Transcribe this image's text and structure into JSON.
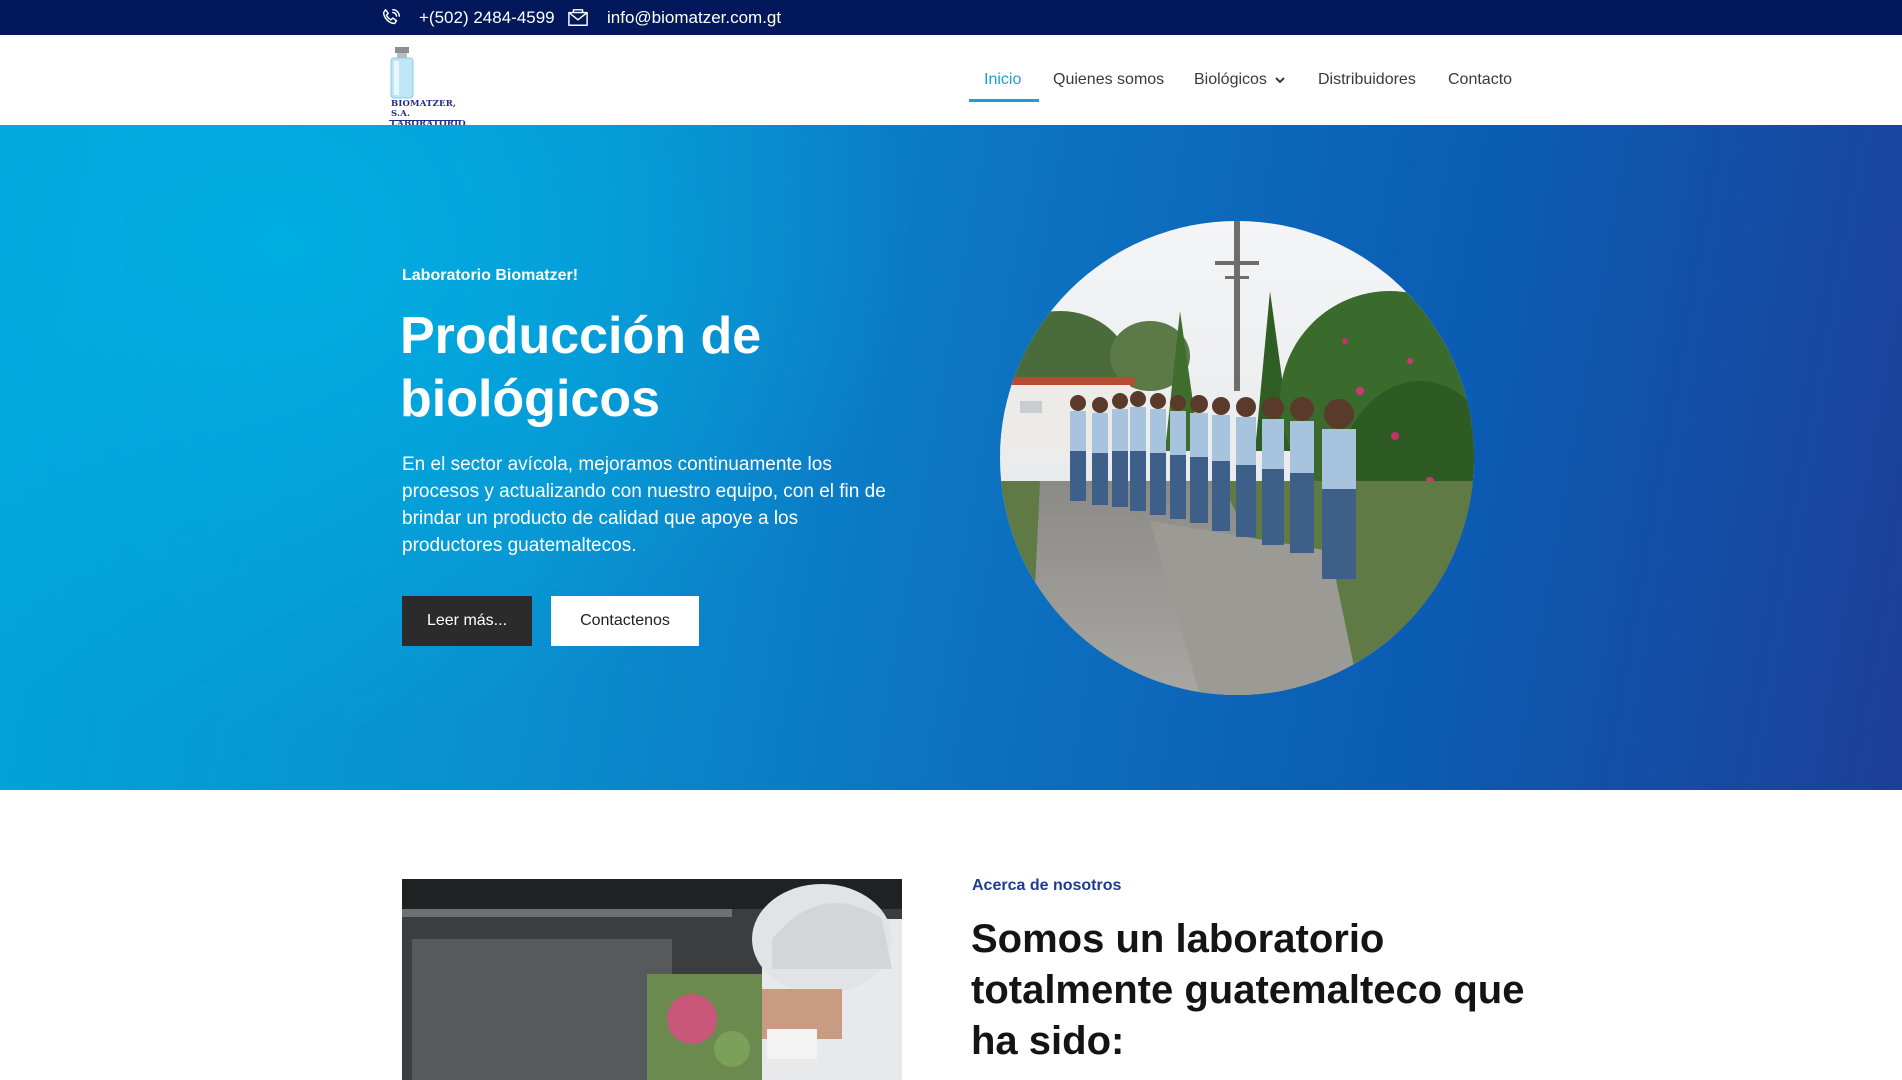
{
  "topbar": {
    "phone_icon": "phone-icon",
    "phone": "+(502) 2484-4599",
    "email_icon": "envelope-icon",
    "email": "info@biomatzer.com.gt"
  },
  "logo": {
    "line1": "BIOMATZER, S.A.",
    "line2": "LABORATORIO"
  },
  "nav": {
    "items": [
      {
        "label": "Inicio"
      },
      {
        "label": "Quienes somos"
      },
      {
        "label": "Biológicos"
      },
      {
        "label": "Distribuidores"
      },
      {
        "label": "Contacto"
      }
    ],
    "dropdown_icon": "chevron-down-icon"
  },
  "hero": {
    "eyebrow": "Laboratorio Biomatzer!",
    "title": "Producción de biológicos",
    "description": "En el sector avícola, mejoramos continuamente los procesos y actualizando con nuestro equipo, con el fin de brindar un producto de calidad que apoye a los productores guatemaltecos.",
    "button_primary": "Leer más...",
    "button_secondary": "Contactenos"
  },
  "about": {
    "eyebrow": "Acerca de nosotros",
    "title": "Somos un laboratorio totalmente guatemalteco que ha sido:"
  },
  "colors": {
    "topbar": "#03185a",
    "accent": "#1aa0d8",
    "hero_start": "#00a6dc",
    "hero_end": "#1d3f98",
    "dark_button": "#2b2b2b",
    "about_eyebrow": "#1f3c94"
  }
}
